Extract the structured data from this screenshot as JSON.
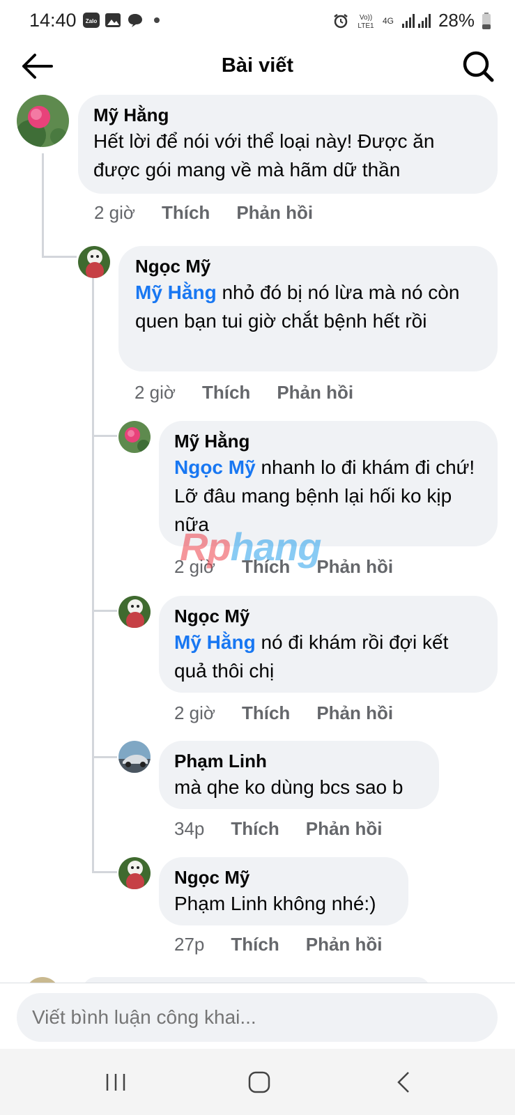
{
  "status": {
    "time": "14:40",
    "network": "4G",
    "battery": "28%",
    "icons": [
      "zalo-icon",
      "gallery-icon",
      "message-icon",
      "dot-icon",
      "alarm-icon",
      "volte-icon",
      "signal-icon",
      "battery-icon"
    ]
  },
  "header": {
    "title": "Bài viết"
  },
  "comments": [
    {
      "name": "Mỹ Hằng",
      "mention": "",
      "text": "Hết lời để nói với thể loại này! Được ăn được gói mang về mà hãm dữ thần",
      "time": "2 giờ",
      "like": "Thích",
      "reply": "Phản hồi"
    },
    {
      "name": "Ngọc Mỹ",
      "mention": "Mỹ Hằng",
      "text": " nhỏ đó bị nó lừa mà nó còn quen bạn tui giờ chắt bệnh hết rồi",
      "time": "2 giờ",
      "like": "Thích",
      "reply": "Phản hồi"
    },
    {
      "name": "Mỹ Hằng",
      "mention": "Ngọc Mỹ",
      "text": " nhanh lo đi khám đi chứ! Lỡ đâu mang bệnh lại hối ko kịp nữa",
      "time": "2 giờ",
      "like": "Thích",
      "reply": "Phản hồi"
    },
    {
      "name": "Ngọc Mỹ",
      "mention": "Mỹ Hằng",
      "text": " nó đi khám rồi đợi kết quả thôi chị",
      "time": "2 giờ",
      "like": "Thích",
      "reply": "Phản hồi"
    },
    {
      "name": "Phạm Linh",
      "mention": "",
      "text": "mà qhe ko dùng bcs sao b",
      "time": "34p",
      "like": "Thích",
      "reply": "Phản hồi"
    },
    {
      "name": "Ngọc Mỹ",
      "mention": "",
      "text": "Phạm Linh không nhé:)",
      "time": "27p",
      "like": "Thích",
      "reply": "Phản hồi"
    }
  ],
  "watermark": {
    "part1": "Rp",
    "part2": "hang"
  },
  "composer": {
    "placeholder": "Viết bình luận công khai..."
  },
  "colors": {
    "bubble": "#f0f2f5",
    "mention": "#1877f2",
    "meta": "#65676b"
  }
}
